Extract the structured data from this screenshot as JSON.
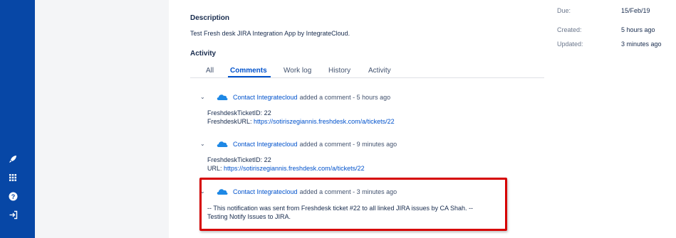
{
  "colors": {
    "nav_bg": "#0747a6",
    "link": "#0052cc",
    "highlight_border": "#d60000",
    "side_panel_bg": "#f4f5f7"
  },
  "nav": {
    "icons": [
      "rocket-icon",
      "app-switcher-icon",
      "help-icon",
      "logout-icon"
    ]
  },
  "description": {
    "title": "Description",
    "text": "Test Fresh desk JIRA Integration App by IntegrateCloud."
  },
  "activity": {
    "title": "Activity",
    "tabs": [
      {
        "label": "All",
        "active": false
      },
      {
        "label": "Comments",
        "active": true
      },
      {
        "label": "Work log",
        "active": false
      },
      {
        "label": "History",
        "active": false
      },
      {
        "label": "Activity",
        "active": false
      }
    ]
  },
  "comments": [
    {
      "author": "Contact Integratecloud",
      "action": "added a comment - 5 hours ago",
      "line1": "FreshdeskTicketID: 22",
      "line2_label": "FreshdeskURL: ",
      "line2_link": "https://sotiriszegiannis.freshdesk.com/a/tickets/22"
    },
    {
      "author": "Contact Integratecloud",
      "action": "added a comment - 9 minutes ago",
      "line1": "FreshdeskTicketID: 22",
      "line2_label": "URL: ",
      "line2_link": "https://sotiriszegiannis.freshdesk.com/a/tickets/22"
    },
    {
      "author": "Contact Integratecloud",
      "action": "added a comment - 3 minutes ago",
      "line1": "-- This notification was sent from Freshdesk ticket #22 to all linked JIRA issues by CA Shah. --",
      "line2": "Testing Notify Issues to JIRA."
    }
  ],
  "dates": [
    {
      "label": "Due:",
      "value": "15/Feb/19"
    },
    {
      "label": "Created:",
      "value": "5 hours ago"
    },
    {
      "label": "Updated:",
      "value": "3 minutes ago"
    }
  ]
}
